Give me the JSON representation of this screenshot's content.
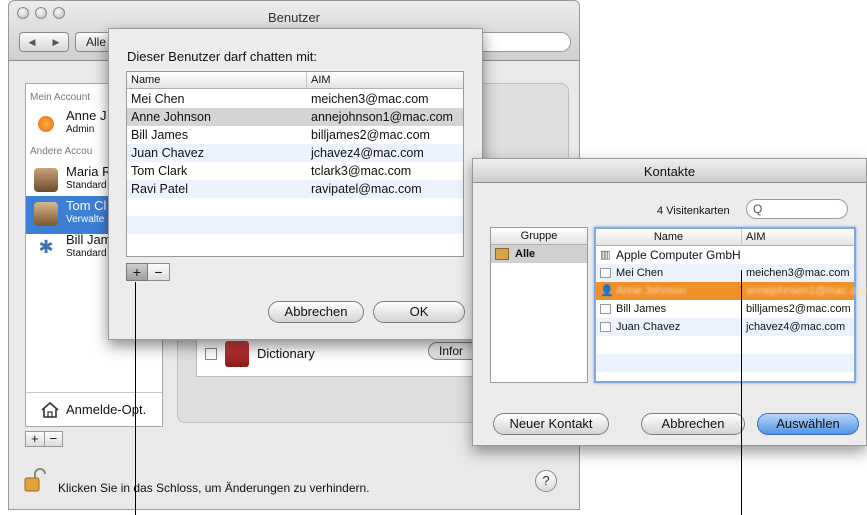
{
  "background_window": {
    "title": "Benutzer",
    "show_all_label": "Alle",
    "account_list": {
      "my_account_header": "Mein Account",
      "other_accounts_header": "Andere Accou",
      "accounts": [
        {
          "name": "Anne J",
          "role": "Admin"
        },
        {
          "name": "Maria R",
          "role": "Standard"
        },
        {
          "name": "Tom Cl",
          "role": "Verwalte"
        },
        {
          "name": "Bill Jam",
          "role": "Standard"
        }
      ],
      "login_options_label": "Anmelde-Opt."
    },
    "add_label": "+",
    "remove_label": "−",
    "dictionary_label": "Dictionary",
    "info_button_label": "Infor",
    "lock_text": "Klicken Sie in das Schloss, um Änderungen zu verhindern.",
    "help_label": "?"
  },
  "chat_sheet": {
    "title": "Dieser Benutzer darf chatten mit:",
    "columns": [
      "Name",
      "AIM"
    ],
    "rows": [
      {
        "name": "Mei Chen",
        "aim": "meichen3@mac.com"
      },
      {
        "name": "Anne Johnson",
        "aim": "annejohnson1@mac.com"
      },
      {
        "name": "Bill James",
        "aim": "billjames2@mac.com"
      },
      {
        "name": "Juan Chavez",
        "aim": "jchavez4@mac.com"
      },
      {
        "name": "Tom Clark",
        "aim": "tclark3@mac.com"
      },
      {
        "name": "Ravi Patel",
        "aim": "ravipatel@mac.com"
      }
    ],
    "add_label": "+",
    "remove_label": "−",
    "cancel_label": "Abbrechen",
    "ok_label": "OK"
  },
  "contacts_window": {
    "title": "Kontakte",
    "count_label": "4 Visitenkarten",
    "search_icon": "Q",
    "group_header": "Gruppe",
    "group_all": "Alle",
    "columns": [
      "Name",
      "AIM"
    ],
    "rows": [
      {
        "name": "Apple Computer GmbH",
        "aim": ""
      },
      {
        "name": "Mei Chen",
        "aim": "meichen3@mac.com"
      },
      {
        "name": "Anne Johnson",
        "aim": "annejohnson1@mac.com"
      },
      {
        "name": "Bill James",
        "aim": "billjames2@mac.com"
      },
      {
        "name": "Juan Chavez",
        "aim": "jchavez4@mac.com"
      }
    ],
    "new_contact_label": "Neuer Kontakt",
    "cancel_label": "Abbrechen",
    "select_label": "Auswählen"
  },
  "colors": {
    "selection_blue": "#3d7fd4",
    "selection_orange": "#f0902a",
    "default_button_blue": "#5593e5"
  }
}
